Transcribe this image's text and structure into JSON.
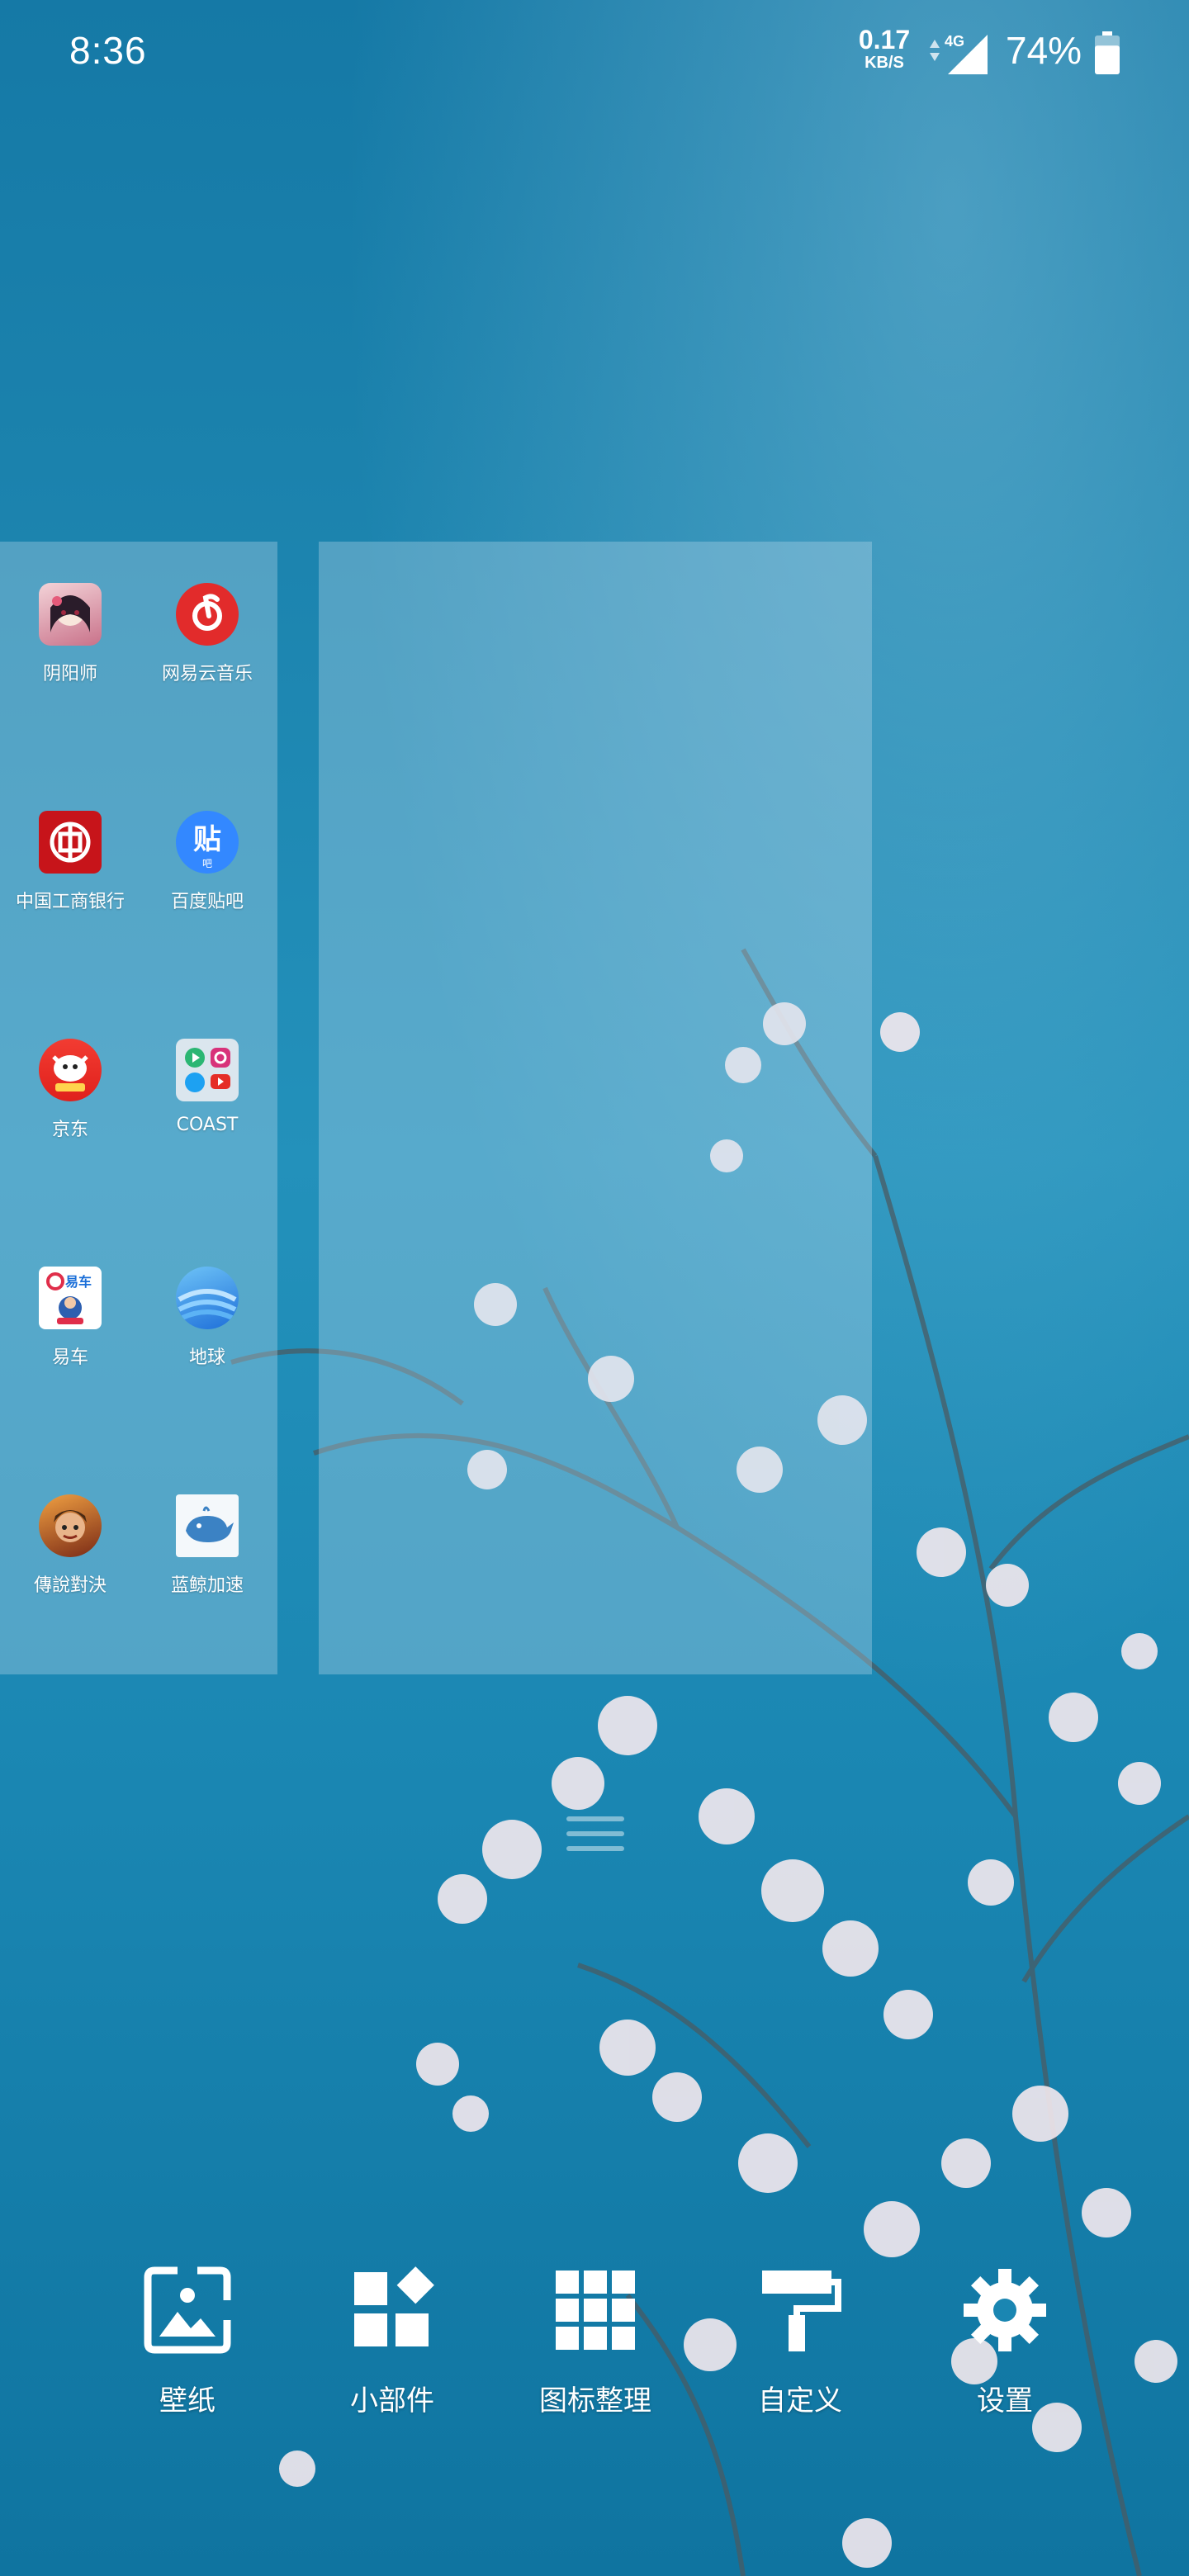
{
  "status_bar": {
    "time": "8:36",
    "net_speed": "0.17",
    "net_unit": "KB/S",
    "network_type": "4G",
    "battery_percent": "74%",
    "battery_level": 0.74
  },
  "apps": [
    {
      "label": "阴阳师",
      "icon": "onmyoji-icon"
    },
    {
      "label": "网易云音乐",
      "icon": "netease-music-icon"
    },
    {
      "label": "中国工商银行",
      "icon": "icbc-icon"
    },
    {
      "label": "百度贴吧",
      "icon": "baidu-tieba-icon"
    },
    {
      "label": "京东",
      "icon": "jd-icon"
    },
    {
      "label": "COAST",
      "icon": "coast-icon"
    },
    {
      "label": "易车",
      "icon": "yiche-icon"
    },
    {
      "label": "地球",
      "icon": "earth-icon"
    },
    {
      "label": "傳說對決",
      "icon": "arena-of-valor-icon"
    },
    {
      "label": "蓝鲸加速",
      "icon": "bluewhale-vpn-icon"
    }
  ],
  "menu": [
    {
      "label": "壁纸",
      "icon": "wallpaper-icon"
    },
    {
      "label": "小部件",
      "icon": "widgets-icon"
    },
    {
      "label": "图标整理",
      "icon": "icon-grid-icon"
    },
    {
      "label": "自定义",
      "icon": "paint-roller-icon"
    },
    {
      "label": "设置",
      "icon": "gear-icon"
    }
  ],
  "colors": {
    "background": "#1b82ad",
    "page_overlay": "#c8e1f0",
    "netease_red": "#e22b2b",
    "icbc_red": "#c7141a",
    "tieba_blue": "#3388ff"
  }
}
